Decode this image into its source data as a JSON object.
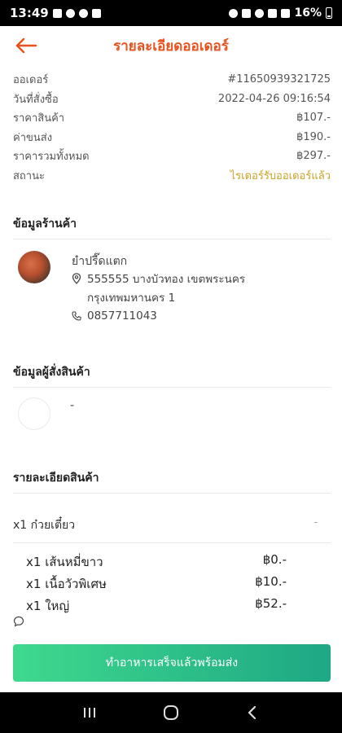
{
  "status_bar": {
    "time": "13:49",
    "battery": "16%"
  },
  "header": {
    "title": "รายละเอียดออเดอร์"
  },
  "order": {
    "rows": [
      {
        "label": "ออเดอร์",
        "value": "#1165093932172​5"
      },
      {
        "label": "วันที่สั่งซื้อ",
        "value": "2022-04-26 09:16:54"
      },
      {
        "label": "ราคาสินค้า",
        "value": "฿107.-"
      },
      {
        "label": "ค่าขนส่ง",
        "value": "฿190.-"
      },
      {
        "label": "ราคารวมทั้งหมด",
        "value": "฿297.-"
      },
      {
        "label": "สถานะ",
        "value": "ไรเดอร์รับออเดอร์แล้ว"
      }
    ],
    "status_color": "#c9a227"
  },
  "shop": {
    "section_title": "ข้อมูลร้านค้า",
    "name": "ยำปรี๊ดแตก",
    "address": "555555 บางบัวทอง เขตพระนคร กรุงเทพมหานคร 1",
    "phone": "0857711043"
  },
  "buyer": {
    "section_title": "ข้อมูลผู้สั่งสินค้า",
    "name": "-"
  },
  "items": {
    "section_title": "รายละเอียดสินค้า",
    "main": {
      "label": "x1 ก๋วยเตี๋ยว",
      "price": "-"
    },
    "options": [
      {
        "label": "x1 เส้นหมี่ขาว",
        "price": "฿0.-"
      },
      {
        "label": "x1 เนื้อวัวพิเศษ",
        "price": "฿10.-"
      },
      {
        "label": "x1 ใหญ่",
        "price": "฿52.-"
      }
    ]
  },
  "action": {
    "label": "ทำอาหารเสร็จแล้วพร้อมส่ง"
  },
  "colors": {
    "accent": "#e8521f",
    "button_start": "#3fd98e",
    "button_end": "#1ea884"
  }
}
